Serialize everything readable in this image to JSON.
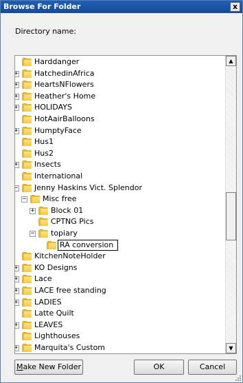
{
  "window": {
    "title": "Browse For Folder",
    "close_glyph": "x"
  },
  "directory_label": "Directory name:",
  "tree": {
    "items": [
      {
        "label": "Harddanger",
        "level": 2,
        "expander": "none"
      },
      {
        "label": "HatchedinAfrica",
        "level": 2,
        "expander": "plus"
      },
      {
        "label": "HeartsNFlowers",
        "level": 2,
        "expander": "plus"
      },
      {
        "label": "Heather's Home",
        "level": 2,
        "expander": "plus"
      },
      {
        "label": "HOLIDAYS",
        "level": 2,
        "expander": "plus"
      },
      {
        "label": "HotAairBalloons",
        "level": 2,
        "expander": "none"
      },
      {
        "label": "HumptyFace",
        "level": 2,
        "expander": "plus"
      },
      {
        "label": "Hus1",
        "level": 2,
        "expander": "none"
      },
      {
        "label": "Hus2",
        "level": 2,
        "expander": "none"
      },
      {
        "label": "Insects",
        "level": 2,
        "expander": "plus"
      },
      {
        "label": "International",
        "level": 2,
        "expander": "none"
      },
      {
        "label": "Jenny Haskins Vict. Splendor",
        "level": 2,
        "expander": "minus"
      },
      {
        "label": "Misc free",
        "level": 3,
        "expander": "minus"
      },
      {
        "label": "Block 01",
        "level": 4,
        "expander": "plus"
      },
      {
        "label": "CPTNG Pics",
        "level": 4,
        "expander": "none"
      },
      {
        "label": "topiary",
        "level": 4,
        "expander": "minus"
      },
      {
        "label": "RA conversion",
        "level": 5,
        "expander": "none",
        "editing": true
      },
      {
        "label": "KitchenNoteHolder",
        "level": 2,
        "expander": "none"
      },
      {
        "label": "KO Designs",
        "level": 2,
        "expander": "plus"
      },
      {
        "label": "Lace",
        "level": 2,
        "expander": "plus"
      },
      {
        "label": "LACE free standing",
        "level": 2,
        "expander": "plus"
      },
      {
        "label": "LADIES",
        "level": 2,
        "expander": "plus"
      },
      {
        "label": "Latte Quilt",
        "level": 2,
        "expander": "none"
      },
      {
        "label": "LEAVES",
        "level": 2,
        "expander": "plus"
      },
      {
        "label": "Lighthouses",
        "level": 2,
        "expander": "none"
      },
      {
        "label": "Marquita's Custom",
        "level": 2,
        "expander": "plus"
      }
    ]
  },
  "scrollbar": {
    "up_glyph": "▲",
    "down_glyph": "▼"
  },
  "buttons": {
    "make_new_folder_accel": "M",
    "make_new_folder_rest": "ake New Folder",
    "ok": "OK",
    "cancel": "Cancel"
  },
  "colors": {
    "titlebar": "#1f5fb8",
    "folder": "#e8b82e"
  }
}
